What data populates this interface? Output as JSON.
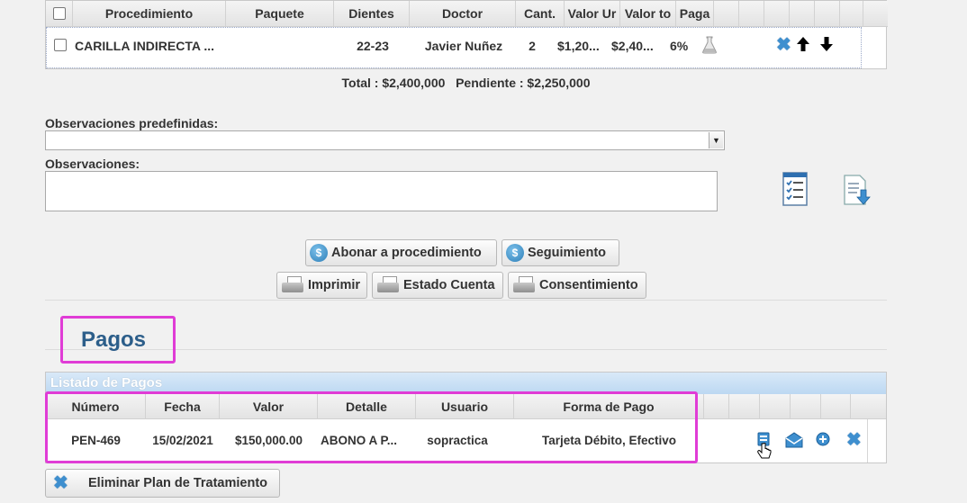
{
  "procedures_table": {
    "columns": [
      "Procedimiento",
      "Paquete",
      "Dientes",
      "Doctor",
      "Cant.",
      "Valor Ur",
      "Valor to",
      "Paga"
    ],
    "row": {
      "procedimiento": "CARILLA INDIRECTA ...",
      "paquete": "",
      "dientes": "22-23",
      "doctor": "Javier Nuñez",
      "cant": "2",
      "valor_unit": "$1,20...",
      "valor_total": "$2,40...",
      "paga": "6%"
    },
    "totals": "Total : $2,400,000   Pendiente : $2,250,000"
  },
  "observaciones_predefinidas_label": "Observaciones predefinidas:",
  "observaciones_predefinidas_value": "",
  "observaciones_label": "Observaciones:",
  "observaciones_value": "",
  "buttons": {
    "abonar": "Abonar a procedimiento",
    "seguimiento": "Seguimiento",
    "imprimir": "Imprimir",
    "estado_cuenta": "Estado Cuenta",
    "consentimiento": "Consentimiento",
    "eliminar_plan": "Eliminar Plan de Tratamiento"
  },
  "pagos": {
    "title": "Pagos",
    "caption": "Listado de Pagos",
    "columns": [
      "Número",
      "Fecha",
      "Valor",
      "Detalle",
      "Usuario",
      "Forma de Pago"
    ],
    "row": {
      "numero": "PEN-469",
      "fecha": "15/02/2021",
      "valor": "$150,000.00",
      "detalle": "ABONO A P...",
      "usuario": "sopractica",
      "forma_pago": "Tarjeta Débito, Efectivo"
    }
  },
  "colors": {
    "accent": "#2c5e8a",
    "highlight": "#e03cd6",
    "icon_blue": "#3e8fcf"
  }
}
